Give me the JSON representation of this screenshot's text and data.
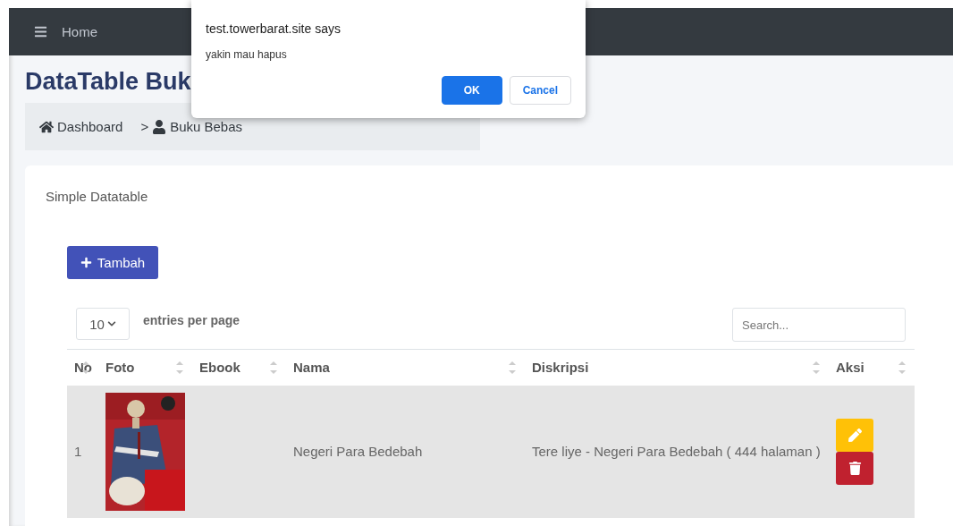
{
  "navbar": {
    "menu_label": "Home"
  },
  "dialog": {
    "title": "test.towerbarat.site says",
    "message": "yakin mau hapus",
    "buttons": [
      {
        "label": "OK",
        "kind": "primary"
      },
      {
        "label": "Cancel",
        "kind": "secondary"
      }
    ]
  },
  "page_title": "DataTable Buk",
  "breadcrumb": [
    {
      "label": "Dashboard",
      "kind": "home"
    },
    {
      "label": "Buku Bebas",
      "kind": "user",
      "separator": ">"
    }
  ],
  "card": {
    "title": "Simple Datatable",
    "add_button": "Tambah",
    "entries": {
      "value": "10",
      "label": "entries per page"
    },
    "search": {
      "placeholder": "Search..."
    },
    "table": {
      "columns": [
        "No",
        "Foto",
        "Ebook",
        "Nama",
        "Diskripsi",
        "Aksi"
      ],
      "rows": [
        {
          "no": "1",
          "nama": "Negeri Para Bedebah",
          "diskripsi": "Tere liye - Negeri Para Bedebah ( 444 halaman )",
          "actions": [
            {
              "kind": "edit"
            },
            {
              "kind": "delete"
            }
          ]
        }
      ]
    }
  }
}
